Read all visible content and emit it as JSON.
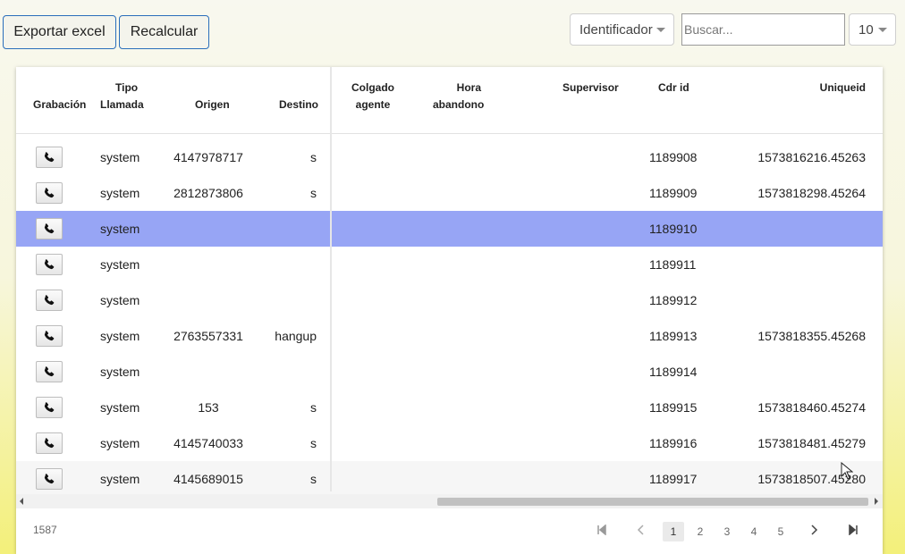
{
  "toolbar": {
    "export_label": "Exportar excel",
    "recalc_label": "Recalcular",
    "field_select": "Identificador",
    "search_placeholder": "Buscar...",
    "page_size": "10"
  },
  "columns": {
    "grabacion": "Grabación",
    "tipo_1": "Tipo",
    "tipo_2": "Llamada",
    "origen": "Origen",
    "destino": "Destino",
    "colgado_1": "Colgado",
    "colgado_2": "agente",
    "hora_1": "Hora",
    "hora_2": "abandono",
    "supervisor": "Supervisor",
    "cdr": "Cdr id",
    "uniqueid": "Uniqueid"
  },
  "rows": [
    {
      "tipo": "system",
      "origen": "4147978717",
      "destino": "s",
      "cdr": "1189908",
      "uniqueid": "1573816216.45263"
    },
    {
      "tipo": "system",
      "origen": "2812873806",
      "destino": "s",
      "cdr": "1189909",
      "uniqueid": "1573818298.45264"
    },
    {
      "tipo": "system",
      "origen": "",
      "destino": "",
      "cdr": "1189910",
      "uniqueid": ""
    },
    {
      "tipo": "system",
      "origen": "",
      "destino": "",
      "cdr": "1189911",
      "uniqueid": ""
    },
    {
      "tipo": "system",
      "origen": "",
      "destino": "",
      "cdr": "1189912",
      "uniqueid": ""
    },
    {
      "tipo": "system",
      "origen": "2763557331",
      "destino": "hangup",
      "cdr": "1189913",
      "uniqueid": "1573818355.45268"
    },
    {
      "tipo": "system",
      "origen": "",
      "destino": "",
      "cdr": "1189914",
      "uniqueid": ""
    },
    {
      "tipo": "system",
      "origen": "153",
      "destino": "s",
      "cdr": "1189915",
      "uniqueid": "1573818460.45274"
    },
    {
      "tipo": "system",
      "origen": "4145740033",
      "destino": "s",
      "cdr": "1189916",
      "uniqueid": "1573818481.45279"
    },
    {
      "tipo": "system",
      "origen": "4145689015",
      "destino": "s",
      "cdr": "1189917",
      "uniqueid": "1573818507.45280"
    }
  ],
  "selected_row_index": 2,
  "footer": {
    "total": "1587",
    "pages": [
      "1",
      "2",
      "3",
      "4",
      "5"
    ],
    "current_page": "1"
  },
  "colors": {
    "selected_row": "#97a5f5",
    "button_border": "#2a6ebb"
  }
}
